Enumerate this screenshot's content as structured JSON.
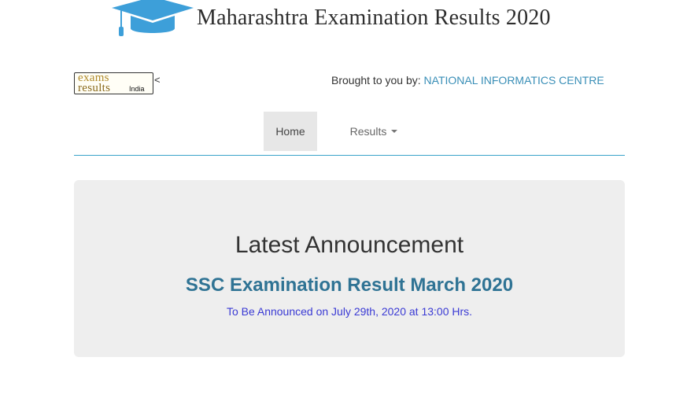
{
  "header": {
    "title": "Maharashtra Examination Results 2020",
    "icon": "graduation-cap-icon",
    "icon_color": "#3d9fd9"
  },
  "brand_logo": {
    "line1": "exams",
    "line2": "results",
    "line3": "India"
  },
  "stray_text": "<",
  "credits": {
    "prefix": "Brought to you by: ",
    "link_text": "NATIONAL INFORMATICS CENTRE",
    "link_color": "#3a8fb7"
  },
  "nav": {
    "items": [
      {
        "label": "Home",
        "active": true
      },
      {
        "label": "Results",
        "has_dropdown": true
      }
    ],
    "border_color": "#3aa3c9"
  },
  "announcement": {
    "heading": "Latest Announcement",
    "result_title": "SSC Examination Result March 2020",
    "date_text": "To Be Announced on July 29th, 2020 at 13:00 Hrs.",
    "result_color": "#2f7394",
    "date_color": "#3a3ad4"
  }
}
